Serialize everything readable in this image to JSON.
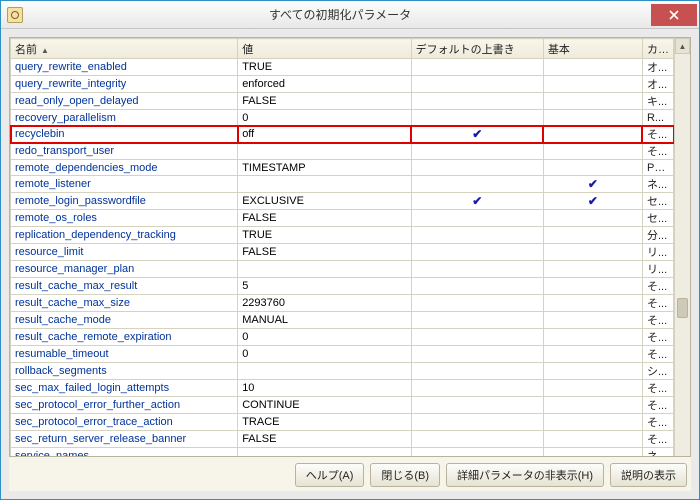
{
  "window": {
    "title": "すべての初期化パラメータ"
  },
  "columns": {
    "name": "名前",
    "value": "値",
    "default_overwrite": "デフォルトの上書き",
    "basic": "基本",
    "category": "カテ..."
  },
  "rows": [
    {
      "name": "query_rewrite_enabled",
      "value": "TRUE",
      "def": false,
      "basic": false,
      "cat": "オ...",
      "hl": false
    },
    {
      "name": "query_rewrite_integrity",
      "value": "enforced",
      "def": false,
      "basic": false,
      "cat": "オ...",
      "hl": false
    },
    {
      "name": "read_only_open_delayed",
      "value": "FALSE",
      "def": false,
      "basic": false,
      "cat": "キ...",
      "hl": false
    },
    {
      "name": "recovery_parallelism",
      "value": "0",
      "def": false,
      "basic": false,
      "cat": "R...",
      "hl": false
    },
    {
      "name": "recyclebin",
      "value": "off",
      "def": true,
      "basic": false,
      "cat": "そ...",
      "hl": true
    },
    {
      "name": "redo_transport_user",
      "value": "",
      "def": false,
      "basic": false,
      "cat": "そ...",
      "hl": false
    },
    {
      "name": "remote_dependencies_mode",
      "value": "TIMESTAMP",
      "def": false,
      "basic": false,
      "cat": "PL/...",
      "hl": false
    },
    {
      "name": "remote_listener",
      "value": "",
      "def": false,
      "basic": true,
      "cat": "ネ...",
      "hl": false
    },
    {
      "name": "remote_login_passwordfile",
      "value": "EXCLUSIVE",
      "def": true,
      "basic": true,
      "cat": "セ...",
      "hl": false
    },
    {
      "name": "remote_os_roles",
      "value": "FALSE",
      "def": false,
      "basic": false,
      "cat": "セ...",
      "hl": false
    },
    {
      "name": "replication_dependency_tracking",
      "value": "TRUE",
      "def": false,
      "basic": false,
      "cat": "分...",
      "hl": false
    },
    {
      "name": "resource_limit",
      "value": "FALSE",
      "def": false,
      "basic": false,
      "cat": "リ...",
      "hl": false
    },
    {
      "name": "resource_manager_plan",
      "value": "",
      "def": false,
      "basic": false,
      "cat": "リ...",
      "hl": false
    },
    {
      "name": "result_cache_max_result",
      "value": "5",
      "def": false,
      "basic": false,
      "cat": "そ...",
      "hl": false
    },
    {
      "name": "result_cache_max_size",
      "value": "2293760",
      "def": false,
      "basic": false,
      "cat": "そ...",
      "hl": false
    },
    {
      "name": "result_cache_mode",
      "value": "MANUAL",
      "def": false,
      "basic": false,
      "cat": "そ...",
      "hl": false
    },
    {
      "name": "result_cache_remote_expiration",
      "value": "0",
      "def": false,
      "basic": false,
      "cat": "そ...",
      "hl": false
    },
    {
      "name": "resumable_timeout",
      "value": "0",
      "def": false,
      "basic": false,
      "cat": "そ...",
      "hl": false
    },
    {
      "name": "rollback_segments",
      "value": "",
      "def": false,
      "basic": false,
      "cat": "シ...",
      "hl": false
    },
    {
      "name": "sec_max_failed_login_attempts",
      "value": "10",
      "def": false,
      "basic": false,
      "cat": "そ...",
      "hl": false
    },
    {
      "name": "sec_protocol_error_further_action",
      "value": "CONTINUE",
      "def": false,
      "basic": false,
      "cat": "そ...",
      "hl": false
    },
    {
      "name": "sec_protocol_error_trace_action",
      "value": "TRACE",
      "def": false,
      "basic": false,
      "cat": "そ...",
      "hl": false
    },
    {
      "name": "sec_return_server_release_banner",
      "value": "FALSE",
      "def": false,
      "basic": false,
      "cat": "そ...",
      "hl": false
    },
    {
      "name": "service_names",
      "value": "",
      "def": false,
      "basic": false,
      "cat": "ネ...",
      "hl": false
    }
  ],
  "buttons": {
    "help": "ヘルプ(A)",
    "close": "閉じる(B)",
    "hide_detail": "詳細パラメータの非表示(H)",
    "show_desc": "説明の表示"
  },
  "glyphs": {
    "check": "✔"
  }
}
